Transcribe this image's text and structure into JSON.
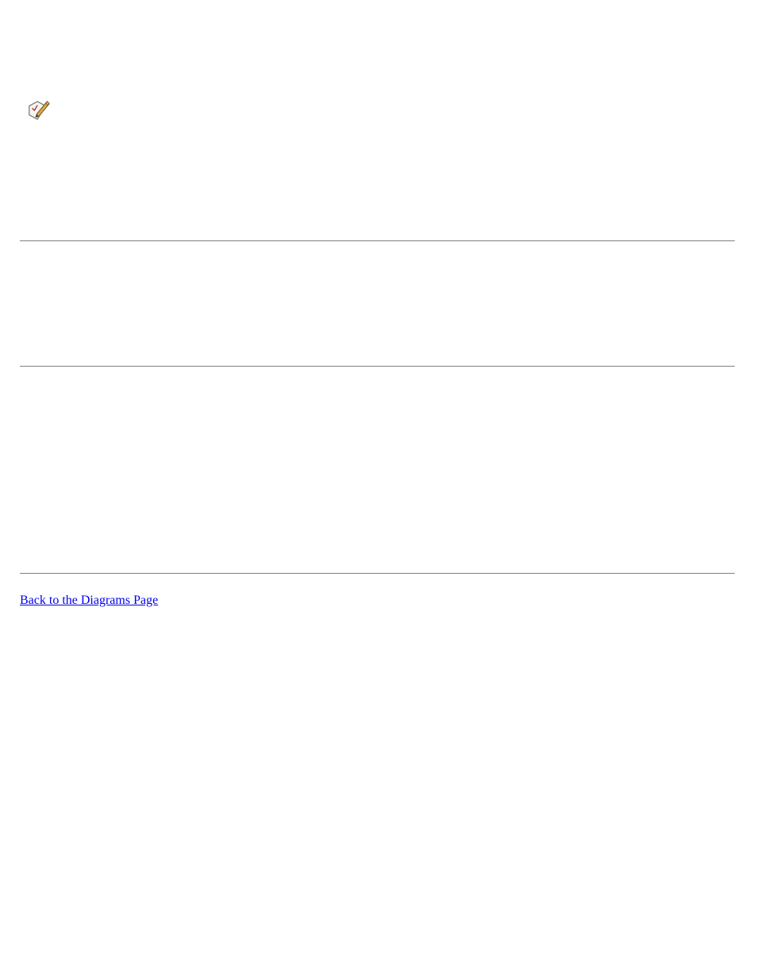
{
  "link": {
    "back_label": "Back to the Diagrams Page"
  }
}
